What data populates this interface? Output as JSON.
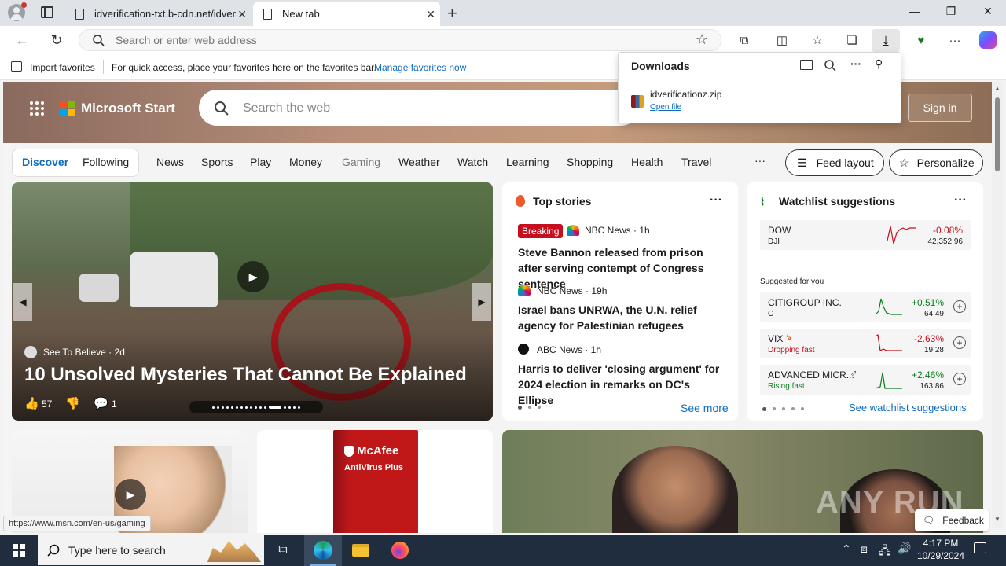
{
  "browser": {
    "tabs": [
      {
        "title": "idverification-txt.b-cdn.net/idver"
      },
      {
        "title": "New tab"
      }
    ],
    "address_placeholder": "Search or enter web address"
  },
  "favorites_bar": {
    "import_label": "Import favorites",
    "message": "For quick access, place your favorites here on the favorites bar.",
    "manage_link": "Manage favorites now"
  },
  "downloads": {
    "title": "Downloads",
    "file_name": "idverificationz.zip",
    "open_link": "Open file"
  },
  "msn": {
    "brand": "Microsoft Start",
    "search_placeholder": "Search the web",
    "sign_in": "Sign in",
    "nav_toggle": [
      "Discover",
      "Following"
    ],
    "nav_items": [
      "News",
      "Sports",
      "Play",
      "Money",
      "Gaming",
      "Weather",
      "Watch",
      "Learning",
      "Shopping",
      "Health",
      "Travel"
    ],
    "nav_more": "···",
    "feed_layout": "Feed layout",
    "personalize": "Personalize",
    "hero": {
      "source": "See To Believe",
      "age": "2d",
      "headline": "10 Unsolved Mysteries That Cannot Be Explained",
      "likes": "57",
      "comments": "1"
    },
    "top_stories": {
      "title": "Top stories",
      "items": [
        {
          "badge": "Breaking",
          "source": "NBC News · 1h",
          "headline": "Steve Bannon released from prison after serving contempt of Congress sentence"
        },
        {
          "badge": "",
          "source": "NBC News · 19h",
          "headline": "Israel bans UNRWA, the U.N. relief agency for Palestinian refugees"
        },
        {
          "badge": "",
          "source": "ABC News · 1h",
          "headline": "Harris to deliver 'closing argument' for 2024 election in remarks on DC's Ellipse"
        }
      ],
      "see_more": "See more"
    },
    "watchlist": {
      "title": "Watchlist suggestions",
      "main": {
        "name": "DOW",
        "ticker": "DJI",
        "change": "-0.08%",
        "price": "42,352.96"
      },
      "suggested_label": "Suggested for you",
      "stocks": [
        {
          "name": "CITIGROUP INC.",
          "sub": "C",
          "change": "+0.51%",
          "price": "64.49",
          "color": "#0a7c1f"
        },
        {
          "name": "VIX",
          "sub": "Dropping fast",
          "change": "-2.63%",
          "price": "19.28",
          "color": "#c50f1f"
        },
        {
          "name": "ADVANCED MICR...",
          "sub": "Rising fast",
          "change": "+2.46%",
          "price": "163.86",
          "color": "#0a7c1f"
        }
      ],
      "see_link": "See watchlist suggestions"
    },
    "feedback": "Feedback",
    "status_url": "https://www.msn.com/en-us/gaming"
  },
  "promo": {
    "brand": "McAfee",
    "product": "AntiVirus Plus"
  },
  "watermark": "ANY RUN",
  "taskbar": {
    "search_placeholder": "Type here to search",
    "time": "4:17 PM",
    "date": "10/29/2024"
  },
  "colors": {
    "accent": "#0f6cbd",
    "breaking": "#c50f1f",
    "taskbar": "#1f2d3f",
    "negative": "#c50f1f",
    "positive": "#0a7c1f"
  }
}
